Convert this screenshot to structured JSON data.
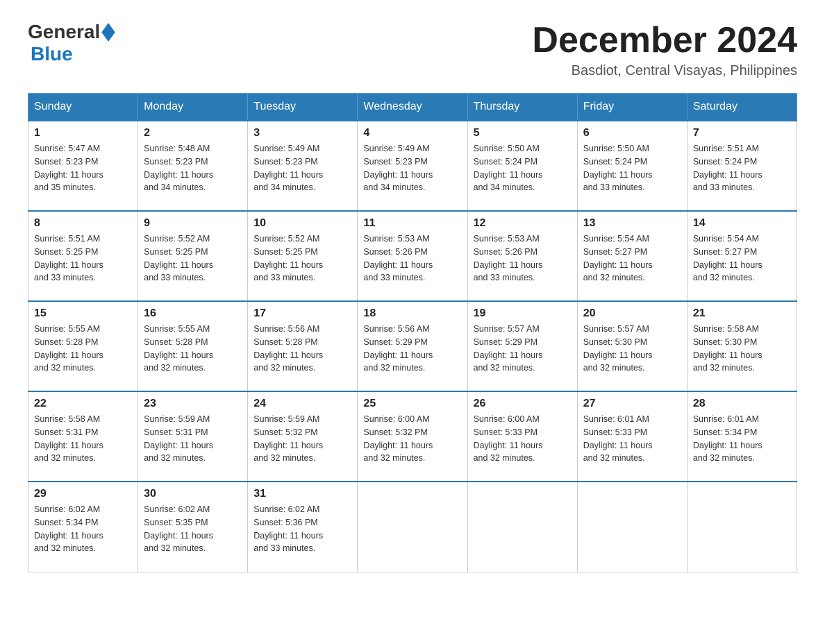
{
  "logo": {
    "general": "General",
    "blue": "Blue"
  },
  "title": "December 2024",
  "subtitle": "Basdiot, Central Visayas, Philippines",
  "days": [
    "Sunday",
    "Monday",
    "Tuesday",
    "Wednesday",
    "Thursday",
    "Friday",
    "Saturday"
  ],
  "weeks": [
    [
      {
        "day": "1",
        "sunrise": "5:47 AM",
        "sunset": "5:23 PM",
        "daylight": "11 hours and 35 minutes."
      },
      {
        "day": "2",
        "sunrise": "5:48 AM",
        "sunset": "5:23 PM",
        "daylight": "11 hours and 34 minutes."
      },
      {
        "day": "3",
        "sunrise": "5:49 AM",
        "sunset": "5:23 PM",
        "daylight": "11 hours and 34 minutes."
      },
      {
        "day": "4",
        "sunrise": "5:49 AM",
        "sunset": "5:23 PM",
        "daylight": "11 hours and 34 minutes."
      },
      {
        "day": "5",
        "sunrise": "5:50 AM",
        "sunset": "5:24 PM",
        "daylight": "11 hours and 34 minutes."
      },
      {
        "day": "6",
        "sunrise": "5:50 AM",
        "sunset": "5:24 PM",
        "daylight": "11 hours and 33 minutes."
      },
      {
        "day": "7",
        "sunrise": "5:51 AM",
        "sunset": "5:24 PM",
        "daylight": "11 hours and 33 minutes."
      }
    ],
    [
      {
        "day": "8",
        "sunrise": "5:51 AM",
        "sunset": "5:25 PM",
        "daylight": "11 hours and 33 minutes."
      },
      {
        "day": "9",
        "sunrise": "5:52 AM",
        "sunset": "5:25 PM",
        "daylight": "11 hours and 33 minutes."
      },
      {
        "day": "10",
        "sunrise": "5:52 AM",
        "sunset": "5:25 PM",
        "daylight": "11 hours and 33 minutes."
      },
      {
        "day": "11",
        "sunrise": "5:53 AM",
        "sunset": "5:26 PM",
        "daylight": "11 hours and 33 minutes."
      },
      {
        "day": "12",
        "sunrise": "5:53 AM",
        "sunset": "5:26 PM",
        "daylight": "11 hours and 33 minutes."
      },
      {
        "day": "13",
        "sunrise": "5:54 AM",
        "sunset": "5:27 PM",
        "daylight": "11 hours and 32 minutes."
      },
      {
        "day": "14",
        "sunrise": "5:54 AM",
        "sunset": "5:27 PM",
        "daylight": "11 hours and 32 minutes."
      }
    ],
    [
      {
        "day": "15",
        "sunrise": "5:55 AM",
        "sunset": "5:28 PM",
        "daylight": "11 hours and 32 minutes."
      },
      {
        "day": "16",
        "sunrise": "5:55 AM",
        "sunset": "5:28 PM",
        "daylight": "11 hours and 32 minutes."
      },
      {
        "day": "17",
        "sunrise": "5:56 AM",
        "sunset": "5:28 PM",
        "daylight": "11 hours and 32 minutes."
      },
      {
        "day": "18",
        "sunrise": "5:56 AM",
        "sunset": "5:29 PM",
        "daylight": "11 hours and 32 minutes."
      },
      {
        "day": "19",
        "sunrise": "5:57 AM",
        "sunset": "5:29 PM",
        "daylight": "11 hours and 32 minutes."
      },
      {
        "day": "20",
        "sunrise": "5:57 AM",
        "sunset": "5:30 PM",
        "daylight": "11 hours and 32 minutes."
      },
      {
        "day": "21",
        "sunrise": "5:58 AM",
        "sunset": "5:30 PM",
        "daylight": "11 hours and 32 minutes."
      }
    ],
    [
      {
        "day": "22",
        "sunrise": "5:58 AM",
        "sunset": "5:31 PM",
        "daylight": "11 hours and 32 minutes."
      },
      {
        "day": "23",
        "sunrise": "5:59 AM",
        "sunset": "5:31 PM",
        "daylight": "11 hours and 32 minutes."
      },
      {
        "day": "24",
        "sunrise": "5:59 AM",
        "sunset": "5:32 PM",
        "daylight": "11 hours and 32 minutes."
      },
      {
        "day": "25",
        "sunrise": "6:00 AM",
        "sunset": "5:32 PM",
        "daylight": "11 hours and 32 minutes."
      },
      {
        "day": "26",
        "sunrise": "6:00 AM",
        "sunset": "5:33 PM",
        "daylight": "11 hours and 32 minutes."
      },
      {
        "day": "27",
        "sunrise": "6:01 AM",
        "sunset": "5:33 PM",
        "daylight": "11 hours and 32 minutes."
      },
      {
        "day": "28",
        "sunrise": "6:01 AM",
        "sunset": "5:34 PM",
        "daylight": "11 hours and 32 minutes."
      }
    ],
    [
      {
        "day": "29",
        "sunrise": "6:02 AM",
        "sunset": "5:34 PM",
        "daylight": "11 hours and 32 minutes."
      },
      {
        "day": "30",
        "sunrise": "6:02 AM",
        "sunset": "5:35 PM",
        "daylight": "11 hours and 32 minutes."
      },
      {
        "day": "31",
        "sunrise": "6:02 AM",
        "sunset": "5:36 PM",
        "daylight": "11 hours and 33 minutes."
      },
      null,
      null,
      null,
      null
    ]
  ]
}
